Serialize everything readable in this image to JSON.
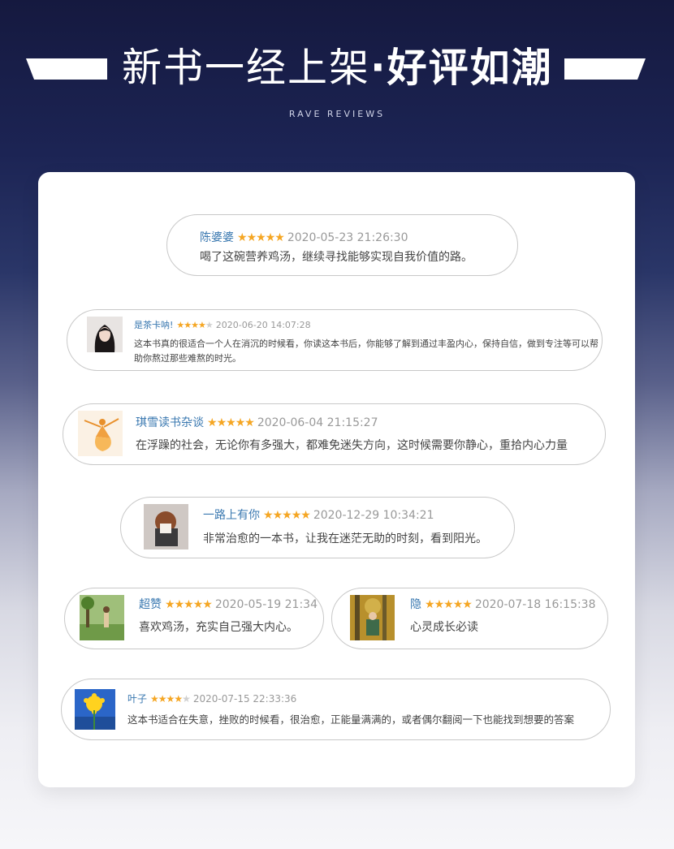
{
  "header": {
    "title_left": "新书一经上架",
    "title_dot": "·",
    "title_right": "好评如潮",
    "subtitle": "RAVE REVIEWS"
  },
  "reviews": [
    {
      "name": "陈婆婆",
      "rating": 5,
      "date": "2020-05-23 21:26:30",
      "text": "喝了这碗营养鸡汤，继续寻找能够实现自我价值的路。"
    },
    {
      "name": "是茶卡呐!",
      "rating": 4,
      "date": "2020-06-20 14:07:28",
      "text": "这本书真的很适合一个人在消沉的时候看，你读这本书后，你能够了解到通过丰盈内心，保持自信，做到专注等可以帮助你熬过那些难熬的时光。"
    },
    {
      "name": "琪雪读书杂谈",
      "rating": 5,
      "date": "2020-06-04 21:15:27",
      "text": "在浮躁的社会，无论你有多强大，都难免迷失方向，这时候需要你静心，重拾内心力量"
    },
    {
      "name": "一路上有你",
      "rating": 5,
      "date": "2020-12-29 10:34:21",
      "text": "非常治愈的一本书，让我在迷茫无助的时刻，看到阳光。"
    },
    {
      "name": "超赞",
      "rating": 5,
      "date": "2020-05-19 21:34",
      "text": "喜欢鸡汤，充实自己强大内心。"
    },
    {
      "name": "隐",
      "rating": 5,
      "date": "2020-07-18 16:15:38",
      "text": "心灵成长必读"
    },
    {
      "name": "叶子",
      "rating": 4,
      "date": "2020-07-15 22:33:36",
      "text": "这本书适合在失意，挫败的时候看，很治愈，正能量满满的，或者偶尔翻阅一下也能找到想要的答案"
    }
  ],
  "colors": {
    "name": "#3a78b0",
    "star": "#f5a623",
    "star_off": "#d0d0d0",
    "date": "#999999"
  }
}
